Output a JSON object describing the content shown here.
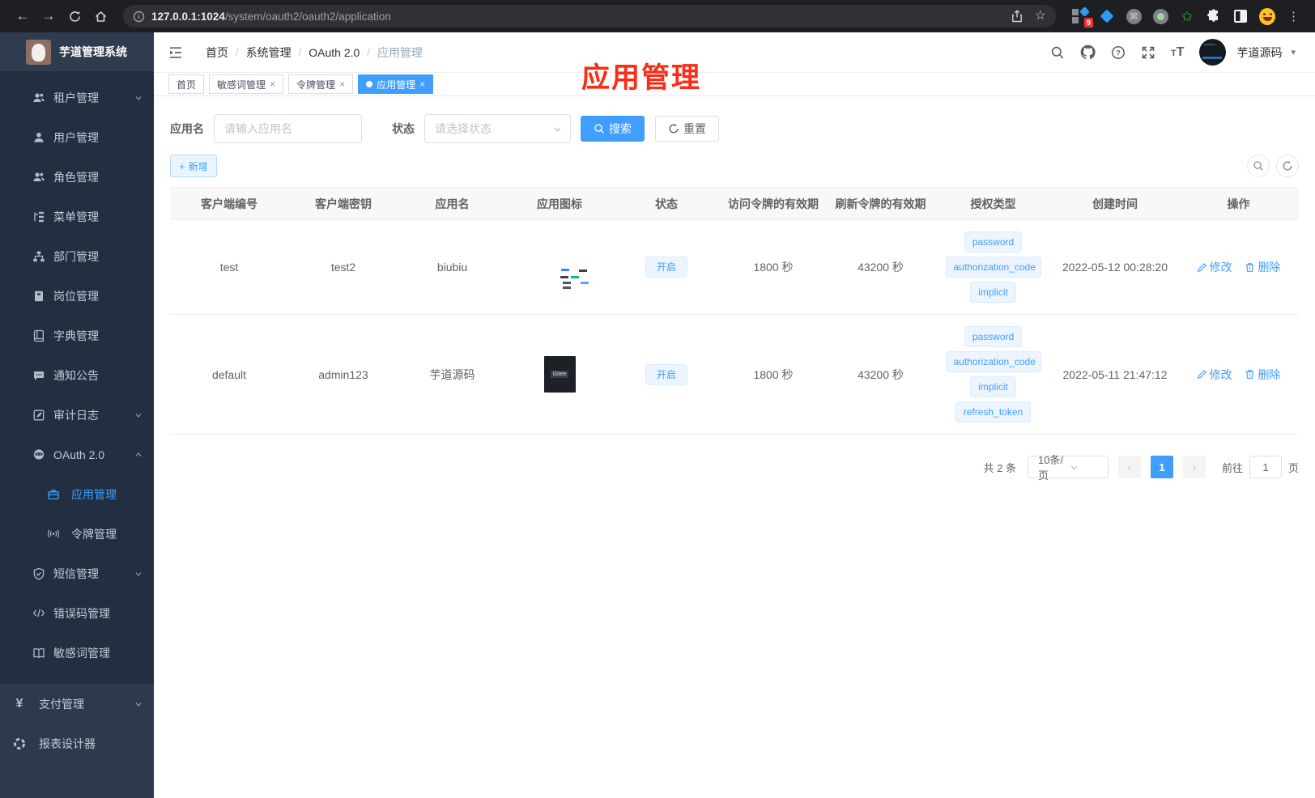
{
  "browser": {
    "url_host": "127.0.0.1:1024",
    "url_path": "/system/oauth2/oauth2/application",
    "extension_badge": "9"
  },
  "annotation": {
    "text": "应用管理"
  },
  "sidebar": {
    "title": "芋道管理系统",
    "menu": [
      {
        "label": "租户管理"
      },
      {
        "label": "用户管理"
      },
      {
        "label": "角色管理"
      },
      {
        "label": "菜单管理"
      },
      {
        "label": "部门管理"
      },
      {
        "label": "岗位管理"
      },
      {
        "label": "字典管理"
      },
      {
        "label": "通知公告"
      },
      {
        "label": "审计日志"
      },
      {
        "label": "OAuth 2.0"
      },
      {
        "label": "应用管理"
      },
      {
        "label": "令牌管理"
      },
      {
        "label": "短信管理"
      },
      {
        "label": "错误码管理"
      },
      {
        "label": "敏感词管理"
      }
    ],
    "bottom_menu": [
      {
        "label": "支付管理"
      },
      {
        "label": "报表设计器"
      }
    ]
  },
  "header": {
    "breadcrumb": [
      "首页",
      "系统管理",
      "OAuth 2.0",
      "应用管理"
    ],
    "username": "芋道源码"
  },
  "tabs": [
    {
      "label": "首页"
    },
    {
      "label": "敏感词管理"
    },
    {
      "label": "令牌管理"
    },
    {
      "label": "应用管理"
    }
  ],
  "filters": {
    "app_name_label": "应用名",
    "app_name_placeholder": "请输入应用名",
    "status_label": "状态",
    "status_placeholder": "请选择状态",
    "search_label": "搜索",
    "reset_label": "重置"
  },
  "toolbar": {
    "add_label": "新增"
  },
  "table": {
    "columns": [
      "客户端编号",
      "客户端密钥",
      "应用名",
      "应用图标",
      "状态",
      "访问令牌的有效期",
      "刷新令牌的有效期",
      "授权类型",
      "创建时间",
      "操作"
    ],
    "rows": [
      {
        "client_id": "test",
        "secret": "test2",
        "name": "biubiu",
        "status": "开启",
        "access_ttl": "1800 秒",
        "refresh_ttl": "43200 秒",
        "grants": [
          "password",
          "authorization_code",
          "implicit"
        ],
        "created": "2022-05-12 00:28:20",
        "edit_label": "修改",
        "delete_label": "删除"
      },
      {
        "client_id": "default",
        "secret": "admin123",
        "name": "芋道源码",
        "status": "开启",
        "access_ttl": "1800 秒",
        "refresh_ttl": "43200 秒",
        "grants": [
          "password",
          "authorization_code",
          "implicit",
          "refresh_token"
        ],
        "created": "2022-05-11 21:47:12",
        "edit_label": "修改",
        "delete_label": "删除"
      }
    ]
  },
  "pagination": {
    "total": "共 2 条",
    "page_size": "10条/页",
    "current_page": "1",
    "goto_label": "前往",
    "goto_value": "1",
    "page_unit": "页"
  }
}
